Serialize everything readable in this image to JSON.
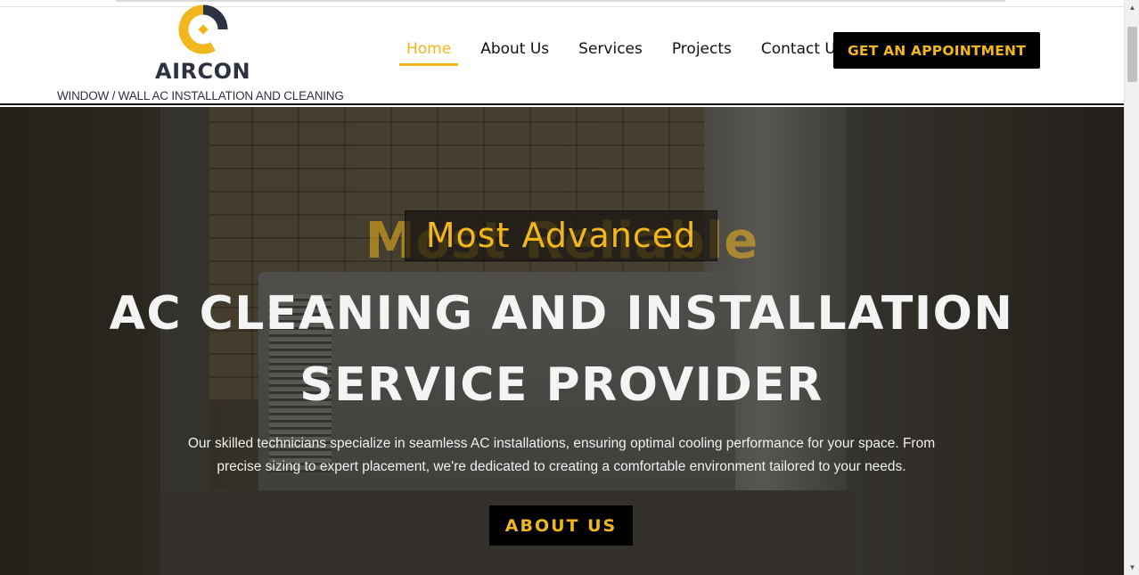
{
  "brand": {
    "name": "AIRCON",
    "tagline": "WINDOW / WALL AC INSTALLATION AND CLEANING",
    "colors": {
      "accent": "#f2b71e",
      "dark": "#2e3142",
      "button_bg": "#000000"
    }
  },
  "nav": {
    "items": [
      {
        "label": "Home",
        "active": true
      },
      {
        "label": "About Us",
        "active": false
      },
      {
        "label": "Services",
        "active": false
      },
      {
        "label": "Projects",
        "active": false
      },
      {
        "label": "Contact Us",
        "active": false
      }
    ],
    "cta_label": "GET AN APPOINTMENT"
  },
  "hero": {
    "rotator_current": "Most Advanced",
    "rotator_previous": "Most Reliable",
    "title": "AC CLEANING AND INSTALLATION SERVICE PROVIDER",
    "description": "Our skilled technicians specialize in seamless AC installations, ensuring optimal cooling performance for your space. From precise sizing to expert placement, we're dedicated to creating a comfortable environment tailored to your needs.",
    "button_label": "ABOUT US"
  }
}
